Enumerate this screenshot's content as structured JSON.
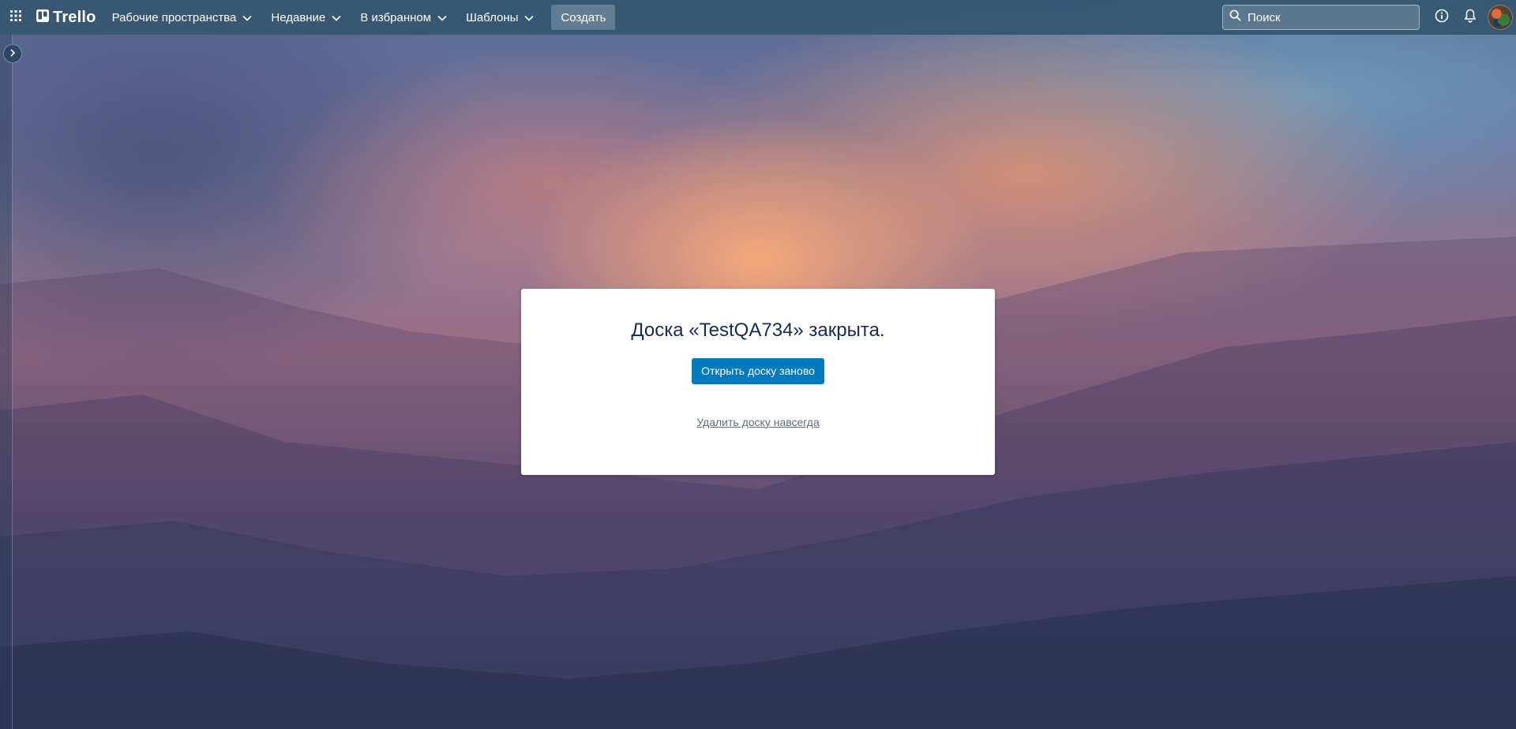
{
  "app": {
    "logo_text": "Trello"
  },
  "header": {
    "nav": [
      {
        "label": "Рабочие пространства"
      },
      {
        "label": "Недавние"
      },
      {
        "label": "В избранном"
      },
      {
        "label": "Шаблоны"
      }
    ],
    "create_label": "Создать",
    "search": {
      "placeholder": "Поиск",
      "value": ""
    },
    "icons": {
      "apps": "grid-icon",
      "info": "info-icon",
      "notifications": "bell-icon",
      "search": "search-icon"
    }
  },
  "sidebar": {
    "toggle_icon": "chevron-right-icon"
  },
  "dialog": {
    "title": "Доска «TestQA734» закрыта.",
    "reopen_label": "Открыть доску заново",
    "delete_label": "Удалить доску навсегда"
  },
  "colors": {
    "topbar": "#345670",
    "primary_button": "#0079bf",
    "title_text": "#172b4d",
    "link_text": "#5e6c84"
  }
}
